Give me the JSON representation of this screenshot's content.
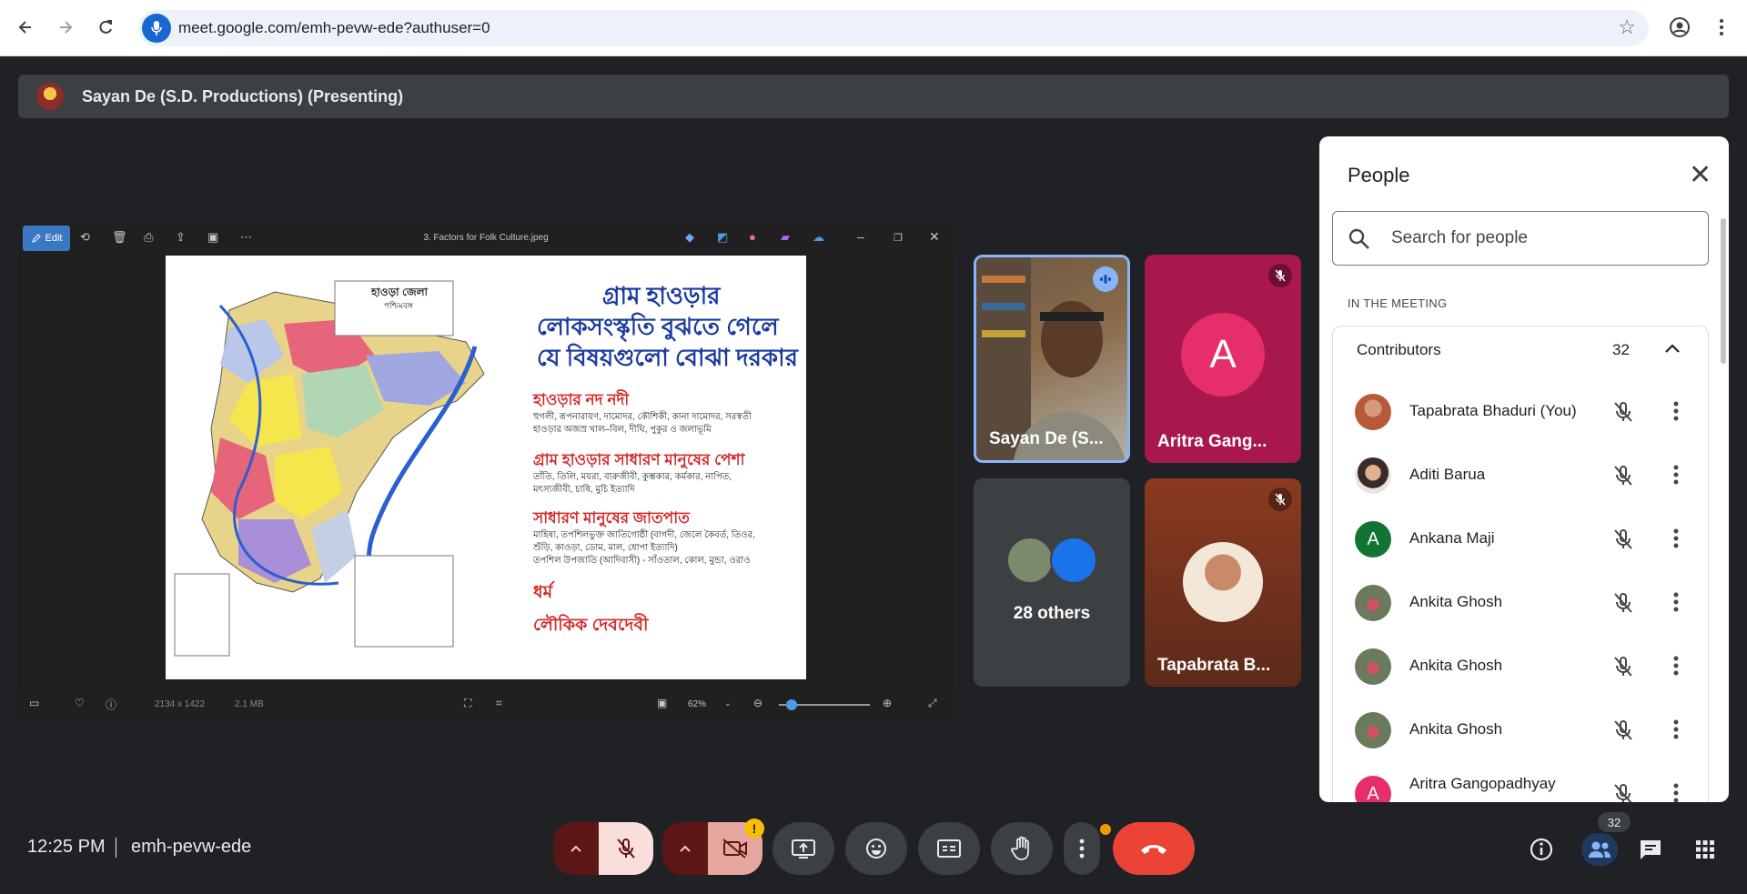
{
  "browser": {
    "url": "meet.google.com/emh-pevw-ede?authuser=0",
    "back_icon": "back-arrow-icon",
    "forward_icon": "forward-arrow-icon",
    "reload_icon": "reload-icon"
  },
  "presenter": {
    "label": "Sayan De (S.D. Productions) (Presenting)"
  },
  "viewer": {
    "edit_label": "Edit",
    "file_title": "3. Factors for Folk Culture.jpeg",
    "dimensions": "2134 x 1422",
    "file_size": "2.1 MB",
    "zoom": "62%",
    "image": {
      "district_title": "হাওড়া জেলা",
      "district_sub": "পশ্চিমবঙ্গ",
      "heading_line1": "গ্রাম হাওড়ার",
      "heading_line2": "লোকসংস্কৃতি বুঝতে গেলে",
      "heading_line3": "যে বিষয়গুলো বোঝা দরকার",
      "rivers_title": "হাওড়ার নদ নদী",
      "rivers_text1": "হুগলী, রূপনারায়ণ, দামোদর, কৌশিকী, কানা দামোদর, সরস্বতী",
      "rivers_text2": "হাওড়ার অজস্র খাল–বিল, দীঘি, পুকুর ও জলাভূমি",
      "occupation_title": "গ্রাম হাওড়ার সাধারণ মানুষের পেশা",
      "occupation_text1": "তাঁতি, তিলি, ময়রা, বারুজীবী, কুম্ভকার, কর্মকার, নাপিত,",
      "occupation_text2": "মৎস্যজীবী, চাষি, মুচি ইত্যাদি",
      "caste_title": "সাধারণ মানুষের জাতপাত",
      "caste_text1": "মাহিষ্য, তপশিলভুক্ত জাতিগোষ্ঠী (বাগদী, জেলে কৈবর্ত, তিওর,",
      "caste_text2": "শুঁড়ি, কাওড়া, ডোম, মাল, ধোপা ইত্যাদি)",
      "caste_text3": "তপশিল উপজাতি (আদিবাসী) - সাঁওতাল, কোল, মুন্ডা, ওরাও",
      "religion_title": "ধর্ম",
      "deity_title": "লৌকিক দেবদেবী"
    }
  },
  "tiles": {
    "sayan": {
      "name": "Sayan De (S...",
      "bg": "#8b6b4a"
    },
    "aritra": {
      "name": "Aritra Gang...",
      "initial": "A",
      "bg": "#a8174d",
      "avatar_bg": "#e62e6b"
    },
    "others": {
      "label": "28 others"
    },
    "tapabrata": {
      "name": "Tapabrata B...",
      "bg": "#7a3a22"
    }
  },
  "people": {
    "title": "People",
    "search_placeholder": "Search for people",
    "section_label": "IN THE MEETING",
    "contributors_label": "Contributors",
    "contributors_count": "32",
    "list": [
      {
        "name": "Tapabrata Bhaduri (You)",
        "avatar_bg": "#b85a3a"
      },
      {
        "name": "Aditi Barua",
        "avatar_bg": "#a87b5c"
      },
      {
        "name": "Ankana Maji",
        "initial": "A",
        "avatar_bg": "#137333"
      },
      {
        "name": "Ankita Ghosh",
        "avatar_bg": "#6a7a5a"
      },
      {
        "name": "Ankita Ghosh",
        "avatar_bg": "#6a7a5a"
      },
      {
        "name": "Ankita Ghosh",
        "avatar_bg": "#6a7a5a"
      },
      {
        "name": "Aritra Gangopadhyay",
        "initial": "A",
        "avatar_bg": "#e62e6b"
      }
    ]
  },
  "bottom": {
    "time": "12:25 PM",
    "meeting_code": "emh-pevw-ede",
    "people_count": "32"
  }
}
